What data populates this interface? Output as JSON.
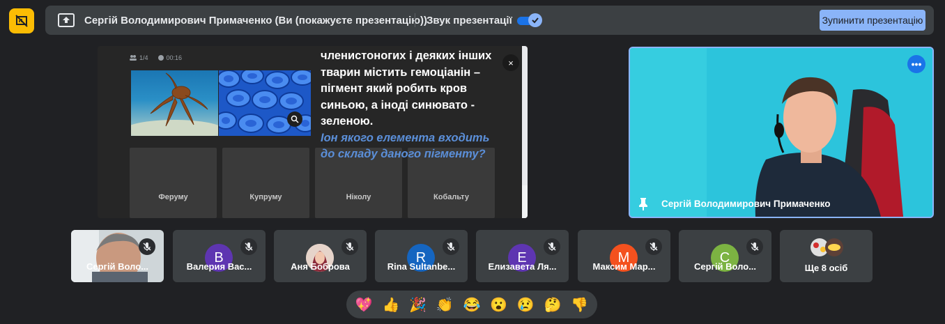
{
  "top_bar": {
    "presenter_text": "Сергій Володимирович Примаченко (Ви (покажуєте презентацію))",
    "sound_label": "Звук презентації",
    "sound_enabled": true,
    "stop_button_label": "Зупинити презентацію"
  },
  "presentation": {
    "page_indicator": "1/4",
    "timer": "00:16",
    "question_text": "членистоногих і деяких інших тварин містить гемоціанін – пігмент який робить кров синьою, а іноді синювато - зеленою.",
    "question_highlight": "Іон якого елемента входить до складу даного пігменту?",
    "close_label": "×",
    "answers": [
      "Феруму",
      "Купруму",
      "Ніколу",
      "Кобальту"
    ]
  },
  "speaker": {
    "name": "Сергій Володимирович Примаченко",
    "more_label": "•••"
  },
  "participants": [
    {
      "name": "Сергій Воло...",
      "initial": "",
      "color": "",
      "type": "video"
    },
    {
      "name": "Валерия Вас...",
      "initial": "В",
      "color": "#5e35b1"
    },
    {
      "name": "Аня Боброва",
      "initial": "",
      "color": "",
      "type": "photo"
    },
    {
      "name": "Rina Sultanbe...",
      "initial": "R",
      "color": "#1565c0"
    },
    {
      "name": "Елизавета Ля...",
      "initial": "Е",
      "color": "#5e35b1"
    },
    {
      "name": "Максим Мар...",
      "initial": "М",
      "color": "#f4511e"
    },
    {
      "name": "Сергій Воло...",
      "initial": "С",
      "color": "#7cb342"
    }
  ],
  "more_participants": "Ще 8 осіб",
  "reactions": [
    "💖",
    "👍",
    "🎉",
    "👏",
    "😂",
    "😮",
    "😢",
    "🤔",
    "👎"
  ]
}
